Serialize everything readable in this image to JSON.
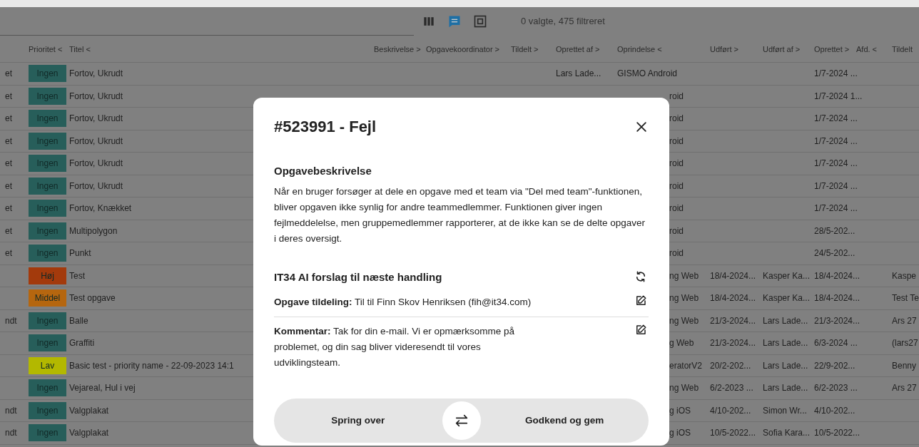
{
  "toolbar": {
    "views": [
      {
        "kind": "columns",
        "selected": false
      },
      {
        "kind": "comments",
        "selected": true
      },
      {
        "kind": "frame",
        "selected": false
      }
    ],
    "summary": "0 valgte, 475 filtreret"
  },
  "table": {
    "columns": [
      "",
      "Prioritet <",
      "Titel <",
      "Beskrivelse >",
      "Opgavekoordinator >",
      "Tildelt >",
      "Oprettet af >",
      "Oprindelse <",
      "Udført >",
      "Udført af >",
      "Oprettet >",
      "Afd. <",
      "Tildelt"
    ],
    "rows": [
      {
        "lead": "et",
        "priority": {
          "label": "Ingen",
          "color": "#275e5a"
        },
        "title": "Fortov, Ukrudt",
        "created_by": "Lars Lade...",
        "origin": "GISMO Android",
        "created": "1/7-2024 ..."
      },
      {
        "lead": "et",
        "priority": {
          "label": "Ingen",
          "color": "#275e5a"
        },
        "title": "Fortov, Ukrudt",
        "origin_tail": "roid",
        "created": "1/7-2024 1..."
      },
      {
        "lead": "et",
        "priority": {
          "label": "Ingen",
          "color": "#275e5a"
        },
        "title": "Fortov, Ukrudt",
        "origin_tail": "roid",
        "created": "1/7-2024 ..."
      },
      {
        "lead": "et",
        "priority": {
          "label": "Ingen",
          "color": "#275e5a"
        },
        "title": "Fortov, Ukrudt",
        "origin_tail": "roid",
        "created": "1/7-2024 ..."
      },
      {
        "lead": "et",
        "priority": {
          "label": "Ingen",
          "color": "#275e5a"
        },
        "title": "Fortov, Ukrudt",
        "origin_tail": "roid",
        "created": "1/7-2024 ..."
      },
      {
        "lead": "et",
        "priority": {
          "label": "Ingen",
          "color": "#275e5a"
        },
        "title": "Fortov, Ukrudt",
        "origin_tail": "roid",
        "created": "1/7-2024 ..."
      },
      {
        "lead": "et",
        "priority": {
          "label": "Ingen",
          "color": "#275e5a"
        },
        "title": "Fortov, Knækket",
        "origin_tail": "roid",
        "created": "1/7-2024 ..."
      },
      {
        "lead": "et",
        "priority": {
          "label": "Ingen",
          "color": "#275e5a"
        },
        "title": "Multipolygon",
        "origin_tail": "roid",
        "created": "28/5-202..."
      },
      {
        "lead": "et",
        "priority": {
          "label": "Ingen",
          "color": "#275e5a"
        },
        "title": "Punkt",
        "origin_tail": "roid",
        "created": "24/5-202..."
      },
      {
        "priority": {
          "label": "Høj",
          "color": "#a33a0c"
        },
        "title": "Test",
        "origin_tail": "ng Web",
        "done": "18/4-2024...",
        "done_by": "Kasper Ka...",
        "created": "18/4-2024...",
        "assigned": "Kaspe"
      },
      {
        "priority": {
          "label": "Middel",
          "color": "#b5660f"
        },
        "title": "Test opgave",
        "origin_tail": "ng Web",
        "done": "18/4-2024...",
        "done_by": "Kasper Ka...",
        "created": "18/4-2024...",
        "assigned": "Test Te"
      },
      {
        "lead": "ndt",
        "priority": {
          "label": "Ingen",
          "color": "#275e5a"
        },
        "title": "Balle",
        "origin_tail": "ng Web",
        "done": "21/3-2024...",
        "done_by": "Lars Lade...",
        "created": "21/3-2024...",
        "assigned": "Ars 27"
      },
      {
        "priority": {
          "label": "Ingen",
          "color": "#275e5a"
        },
        "title": "Graffiti",
        "origin_tail": "g Web",
        "done": "21/3-2024...",
        "done_by": "Lars Lade...",
        "created": "6/3-2024 ...",
        "assigned": "(lars27"
      },
      {
        "priority": {
          "label": "Lav",
          "color": "#b3b800"
        },
        "title": "Basic test - priority name - 22-09-2023 14:1",
        "origin_tail": "eratorV2",
        "done": "20/2-202...",
        "done_by": "Lars Lade...",
        "created": "22/9-202...",
        "assigned": "Benny"
      },
      {
        "priority": {
          "label": "Ingen",
          "color": "#275e5a"
        },
        "title": "Vejareal, Hul i vej",
        "origin_tail": "ng Web",
        "done": "6/2-2023 ...",
        "done_by": "Lars Lade...",
        "created": "6/2-2023 ...",
        "assigned": "Ars 27"
      },
      {
        "lead": "ndt",
        "priority": {
          "label": "Ingen",
          "color": "#275e5a"
        },
        "title": "Valgplakat",
        "origin_tail": "g iOS",
        "done": "4/10-202...",
        "done_by": "Simon Wr...",
        "created": "4/10-202..."
      },
      {
        "lead": "ndt",
        "priority": {
          "label": "Ingen",
          "color": "#275e5a"
        },
        "title": "Valgplakat",
        "origin_tail": "g iOS",
        "done": "10/5-2022...",
        "done_by": "Sofia Kara...",
        "created": "10/5-2022..."
      }
    ]
  },
  "modal": {
    "title": "#523991 - Fejl",
    "description_heading": "Opgavebeskrivelse",
    "description": "Når en bruger forsøger at dele en opgave med et team via \"Del med team\"-funktionen, bliver opgaven ikke synlig for andre teammedlemmer. Funktionen giver ingen fejlmeddelelse, men gruppemedlemmer rapporterer, at de ikke kan se de delte opgaver i deres oversigt.",
    "suggestion_heading": "IT34 AI forslag til næste handling",
    "suggestions": [
      {
        "text": "**Opgave tildeling:** Til til Finn Skov Henriksen (fih@it34.com)"
      },
      {
        "text": "**Kommentar:** Tak for din e-mail. Vi er opmærksomme på problemet, og din sag bliver videresendt til vores udviklingsteam."
      }
    ],
    "skip": "Spring over",
    "approve": "Godkend og gem"
  }
}
